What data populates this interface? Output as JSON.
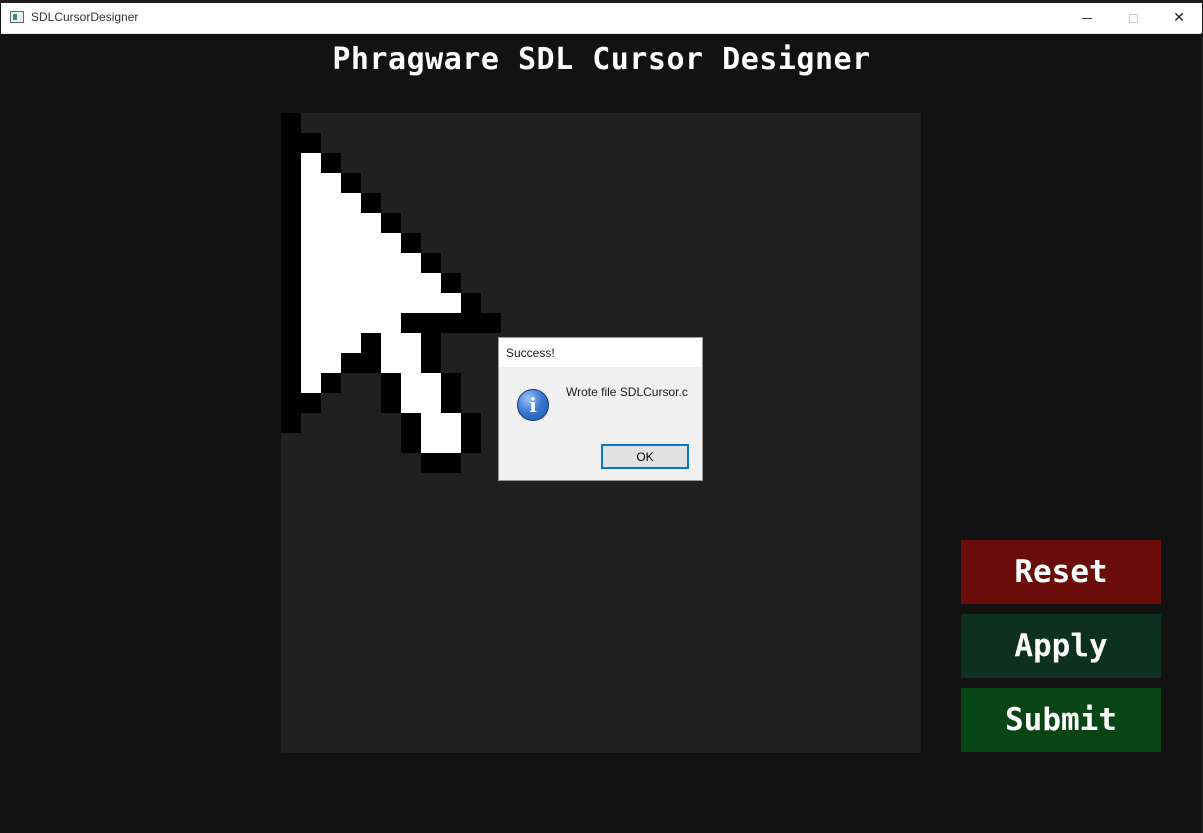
{
  "window": {
    "title": "SDLCursorDesigner",
    "caption_buttons": {
      "minimize_icon": "minimize-icon",
      "maximize_icon": "maximize-icon",
      "close_icon": "close-icon",
      "close_glyph": "✕"
    }
  },
  "app": {
    "title": "Phragware SDL Cursor Designer"
  },
  "canvas": {
    "grid_cells": 32,
    "pixels": [
      "X...............",
      "XX..............",
      "XWX.............",
      "XWWX............",
      "XWWWX...........",
      "XWWWWX..........",
      "XWWWWWX.........",
      "XWWWWWWX........",
      "XWWWWWWWX.......",
      "XWWWWWWWWX......",
      "XWWWWWXXXXX.....",
      "XWWWXWWX........",
      "XWWXXWWX........",
      "XWX..XWWX.......",
      "XX...XWWX.......",
      "X.....XWWX......",
      "......XWWX......",
      ".......XX......."
    ],
    "colors": {
      "background": "#202020",
      "black": "#000000",
      "white": "#ffffff"
    }
  },
  "buttons": {
    "reset": "Reset",
    "apply": "Apply",
    "submit": "Submit"
  },
  "dialog": {
    "title": "Success!",
    "message": "Wrote file SDLCursor.c",
    "icon": "info-icon",
    "icon_glyph": "i",
    "ok_label": "OK"
  }
}
